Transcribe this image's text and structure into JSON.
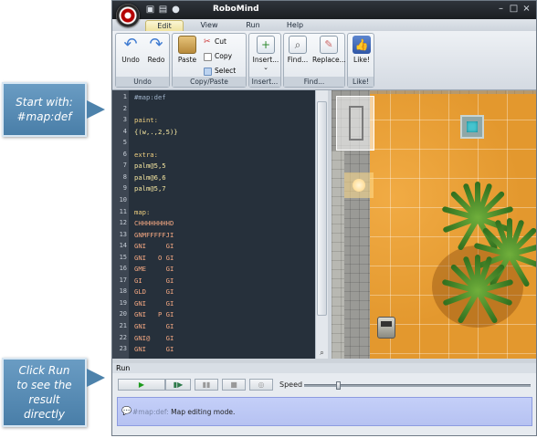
{
  "window": {
    "title": "RoboMind",
    "controls": {
      "minimize": "–",
      "maximize": "□",
      "close": "×"
    }
  },
  "tabs": [
    {
      "label": "Edit",
      "active": true
    },
    {
      "label": "View",
      "active": false
    },
    {
      "label": "Run",
      "active": false
    },
    {
      "label": "Help",
      "active": false
    }
  ],
  "ribbon": {
    "undo_group": {
      "label": "Undo",
      "undo": "Undo",
      "redo": "Redo"
    },
    "clipboard_group": {
      "label": "Copy/Paste",
      "paste": "Paste",
      "cut": "Cut",
      "copy": "Copy",
      "select_all": "Select All"
    },
    "insert_group": {
      "label": "Insert...",
      "insert": "Insert..."
    },
    "find_group": {
      "label": "Find...",
      "find": "Find...",
      "replace": "Replace..."
    },
    "like_group": {
      "label": "Like!",
      "like": "Like!"
    }
  },
  "editor": {
    "line_numbers": [
      "1",
      "2",
      "3",
      "4",
      "5",
      "6",
      "7",
      "8",
      "9",
      "10",
      "11",
      "12",
      "13",
      "14",
      "15",
      "16",
      "17",
      "18",
      "19",
      "20",
      "21",
      "22",
      "23"
    ],
    "lines": [
      "#map:def",
      "",
      "paint:",
      "{(w,.,2,5)}",
      "",
      "extra:",
      "palm@5,5",
      "palm@6,6",
      "palm@5,7",
      "",
      "map:",
      "CHHHHHHHHD",
      "GNMFFFFFJI",
      "GNI     GI",
      "GNI   O GI",
      "GME     GI",
      "GI      GI",
      "GLD     GI",
      "GNI     GI",
      "GNI   P GI",
      "GNI     GI",
      "GNI@    GI",
      "GNI     GI"
    ],
    "current_line": 1
  },
  "run": {
    "header": "Run",
    "speed_label": "Speed",
    "speed_fraction": 0.14,
    "status_prefix": "#map:def:",
    "status_message": "Map editing mode."
  },
  "callouts": {
    "start": {
      "line1": "Start with:",
      "line2": "#map:def"
    },
    "run": {
      "line1": "Click Run",
      "line2": "to see the",
      "line3": "result",
      "line4": "directly"
    }
  },
  "colors": {
    "comment": "#9fb2c9",
    "keyword": "#f0d080",
    "value": "#f5e6a0",
    "map": "#f4a882",
    "sand": "#e3982e",
    "callout": "#5a8eb8"
  }
}
